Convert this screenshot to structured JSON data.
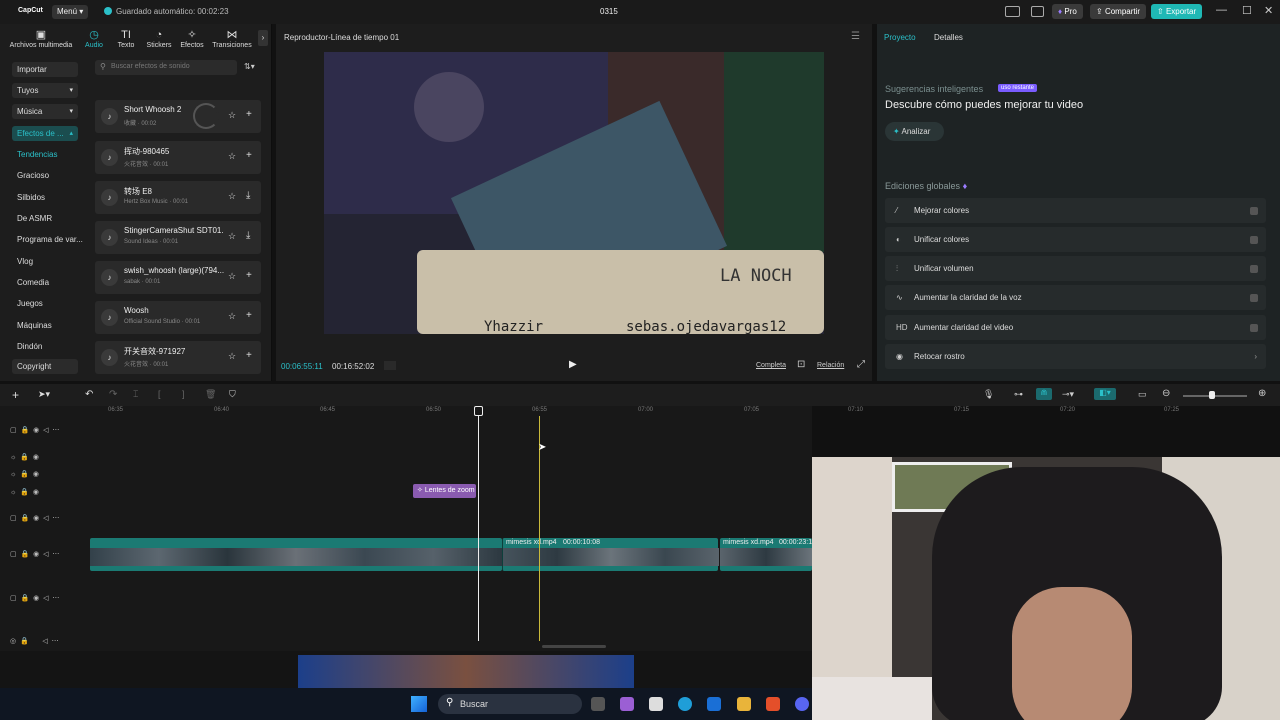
{
  "app": {
    "logo": "CapCut",
    "menu": "Menú",
    "autosave": "Guardado automático: 00:02:23",
    "project_title": "0315",
    "pro": "Pro",
    "share": "Compartir",
    "export": "Exportar"
  },
  "media_tabs": [
    {
      "label": "Archivos multimedia",
      "icon": "media-icon"
    },
    {
      "label": "Audio",
      "icon": "audio-icon"
    },
    {
      "label": "Texto",
      "icon": "text-icon"
    },
    {
      "label": "Stickers",
      "icon": "sticker-icon"
    },
    {
      "label": "Efectos",
      "icon": "effects-icon"
    },
    {
      "label": "Transiciones",
      "icon": "transitions-icon"
    }
  ],
  "categories": [
    "Importar",
    "Tuyos",
    "Música",
    "Efectos de ...",
    "Tendencias",
    "Gracioso",
    "Silbidos",
    "De ASMR",
    "Programa de var...",
    "Vlog",
    "Comedia",
    "Juegos",
    "Máquinas",
    "Dindón",
    "Copyright"
  ],
  "search": {
    "placeholder": "Buscar efectos de sonido"
  },
  "sound_effects": [
    {
      "title": "Short Whoosh 2",
      "sub": "收藏 · 00:02"
    },
    {
      "title": "挥动-980465",
      "sub": "火花音效 · 00:01"
    },
    {
      "title": "转场 E8",
      "sub": "Hertz Box Music · 00:01"
    },
    {
      "title": "StingerCameraShut SDT01...",
      "sub": "Sound Ideas · 00:01"
    },
    {
      "title": "swish_whoosh (large)(794...",
      "sub": "sabak · 00:01"
    },
    {
      "title": "Woosh",
      "sub": "Official Sound Studio · 00:01"
    },
    {
      "title": "开关音效-971927",
      "sub": "火花音效 · 00:01"
    }
  ],
  "player": {
    "title": "Reproductor-Línea de tiempo 01",
    "time_current": "00:06:55:11",
    "time_total": "00:16:52:02",
    "full": "Completa",
    "ratio": "Relación",
    "overlay_a": "LA NOCH",
    "overlay_b": "Yhazzir",
    "overlay_c": "sebas.ojedavargas12"
  },
  "props": {
    "tab_project": "Proyecto",
    "tab_details": "Detalles",
    "smart_label": "Sugerencias inteligentes",
    "badge": "uso restante",
    "headline": "Descubre cómo puedes mejorar tu video",
    "analyze": "Analizar",
    "global_title": "Ediciones globales",
    "global_items": [
      "Mejorar colores",
      "Unificar colores",
      "Unificar volumen",
      "Aumentar la claridad de la voz",
      "Aumentar claridad del video",
      "Retocar rostro"
    ]
  },
  "timeline": {
    "ticks": [
      "06:35",
      "06:40",
      "06:45",
      "06:50",
      "06:55",
      "07:00",
      "07:05",
      "07:10",
      "07:15",
      "07:20",
      "07:25"
    ],
    "effect_clip": "Lentes de zoom",
    "clip1": "mimesis xd.mp4",
    "clip1_dur": "00:00:10:08",
    "clip2": "mimesis xd.mp4",
    "clip2_dur": "00:00:23:1"
  },
  "taskbar": {
    "search": "Buscar"
  },
  "colors": {
    "accent": "#2bc0c9",
    "export": "#1fb8b5",
    "pro": "#7a5cff",
    "clip": "#1b7a73",
    "effect": "#8a5bb0"
  }
}
